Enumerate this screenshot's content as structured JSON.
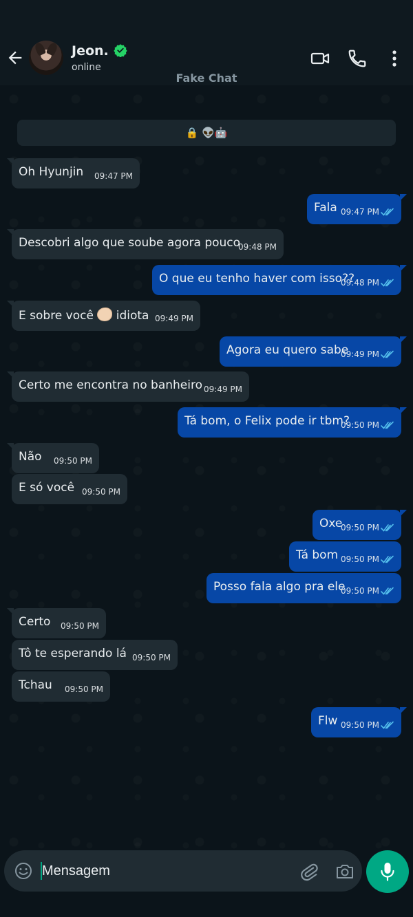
{
  "header": {
    "contact_name": "Jeon.",
    "status": "online",
    "watermark": "Fake Chat"
  },
  "encryption_notice": "🔒 👽🤖",
  "messages": [
    {
      "dir": "in",
      "text": "Oh Hyunjin",
      "time": "09:47 PM"
    },
    {
      "dir": "out",
      "text": "Fala",
      "time": "09:47 PM"
    },
    {
      "dir": "in",
      "text": "Descobri algo que soube agora pouco",
      "time": "09:48 PM"
    },
    {
      "dir": "out",
      "text": "O que eu tenho haver com isso??",
      "time": "09:48 PM"
    },
    {
      "dir": "in",
      "text_before": "E sobre você ",
      "emoji": "hand-emoji",
      "text_after": " idiota",
      "time": "09:49 PM"
    },
    {
      "dir": "out",
      "text": "Agora eu quero sabe",
      "time": "09:49 PM"
    },
    {
      "dir": "in",
      "text": "Certo me encontra no banheiro",
      "time": "09:49 PM"
    },
    {
      "dir": "out",
      "text": "Tá bom, o Felix pode ir tbm?",
      "time": "09:50 PM"
    },
    {
      "dir": "in",
      "text": "Não",
      "time": "09:50 PM"
    },
    {
      "dir": "in",
      "text": "E só você",
      "time": "09:50 PM"
    },
    {
      "dir": "out",
      "text": "Oxe",
      "time": "09:50 PM"
    },
    {
      "dir": "out",
      "text": "Tá bom",
      "time": "09:50 PM"
    },
    {
      "dir": "out",
      "text": "Posso fala algo pra ele",
      "time": "09:50 PM"
    },
    {
      "dir": "in",
      "text": "Certo",
      "time": "09:50 PM"
    },
    {
      "dir": "in",
      "text": "Tô te esperando lá",
      "time": "09:50 PM"
    },
    {
      "dir": "in",
      "text": "Tchau",
      "time": "09:50 PM"
    },
    {
      "dir": "out",
      "text": "Flw",
      "time": "09:50 PM"
    }
  ],
  "composer": {
    "placeholder": "Mensagem"
  },
  "icons": {
    "back": "arrow-left-icon",
    "verified": "verified-badge-icon",
    "video": "video-call-icon",
    "call": "phone-icon",
    "menu": "more-vert-icon",
    "emoji": "emoji-icon",
    "attach": "paperclip-icon",
    "camera": "camera-icon",
    "mic": "microphone-icon",
    "read": "double-check-icon"
  },
  "colors": {
    "background": "#0b141a",
    "header": "#0f191f",
    "incoming_bubble": "#202c33",
    "outgoing_bubble": "#0747a6",
    "accent": "#00a884",
    "read_ticks": "#53bdeb"
  }
}
